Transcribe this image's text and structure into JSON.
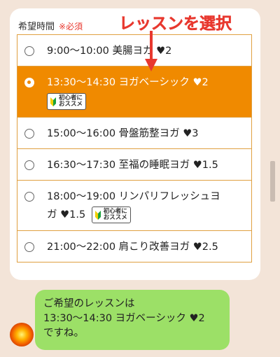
{
  "form": {
    "title": "希望時間",
    "required": "※必須",
    "options": [
      {
        "label": "9:00～10:00 美腸ヨガ ♥2",
        "selected": false,
        "badge": false
      },
      {
        "label": "13:30～14:30 ヨガベーシック ♥2",
        "selected": true,
        "badge": true
      },
      {
        "label": "15:00～16:00 骨盤筋整ヨガ ♥3",
        "selected": false,
        "badge": false
      },
      {
        "label": "16:30～17:30 至福の睡眠ヨガ ♥1.5",
        "selected": false,
        "badge": false
      },
      {
        "label_line1": "18:00～19:00 リンパリフレッシュヨ",
        "label_line2": "ガ ♥1.5",
        "selected": false,
        "badge": true
      },
      {
        "label": "21:00～22:00 肩こり改善ヨガ ♥2.5",
        "selected": false,
        "badge": false
      }
    ]
  },
  "badge": {
    "line1": "初心者に",
    "line2": "おススメ"
  },
  "annotation": "レッスンを選択",
  "chat": {
    "line1": "ご希望のレッスンは",
    "line2": "13:30～14:30 ヨガベーシック ♥2",
    "line3": "ですね。"
  },
  "colors": {
    "accent": "#f08a00",
    "annotation": "#e8382f",
    "bubble": "#9ce067",
    "background": "#f3e4d8"
  }
}
